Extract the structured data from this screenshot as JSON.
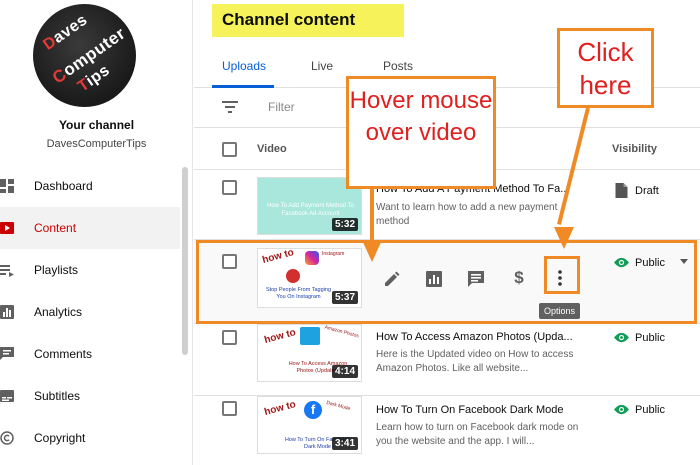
{
  "sidebar": {
    "logo_words": [
      "aves",
      "omputer",
      "ips"
    ],
    "logo_initials": [
      "D",
      "C",
      "T"
    ],
    "channel_label": "Your channel",
    "channel_name": "DavesComputerTips",
    "items": [
      {
        "label": "Dashboard",
        "icon": "dashboard-icon"
      },
      {
        "label": "Content",
        "icon": "content-icon",
        "active": true
      },
      {
        "label": "Playlists",
        "icon": "playlists-icon"
      },
      {
        "label": "Analytics",
        "icon": "analytics-icon"
      },
      {
        "label": "Comments",
        "icon": "comments-icon"
      },
      {
        "label": "Subtitles",
        "icon": "subtitles-icon"
      },
      {
        "label": "Copyright",
        "icon": "copyright-icon"
      }
    ]
  },
  "main": {
    "title": "Channel content",
    "tabs": [
      "Uploads",
      "Live",
      "Posts"
    ],
    "filter_placeholder": "Filter",
    "columns": {
      "video": "Video",
      "visibility": "Visibility"
    },
    "options_tooltip": "Options",
    "rows": [
      {
        "title": "How To Add A Payment Method To Fa...",
        "description": "Want to learn how to add a new payment method",
        "duration": "5:32",
        "visibility": "Draft",
        "thumb_text": "How To Add Payment Method To Facebook Ad Account"
      },
      {
        "title": "",
        "description": "",
        "duration": "5:37",
        "visibility": "Public",
        "thumb_text": "Stop People From Tagging You On Instagram",
        "thumb_tag": "Instagram"
      },
      {
        "title": "How To Access Amazon Photos (Upda...",
        "description": "Here is the Updated video on How to access Amazon Photos. Like all website...",
        "duration": "4:14",
        "visibility": "Public",
        "thumb_text": "How To Access Amazon Photos (Updated)",
        "thumb_tag": "Amazon Photos"
      },
      {
        "title": "How To Turn On Facebook Dark Mode",
        "description": "Learn how to turn on Facebook dark mode on you the website and the app. I will...",
        "duration": "3:41",
        "visibility": "Public",
        "thumb_text": "How To Turn On Facebook Dark Mode",
        "thumb_tag": "Dark Mode"
      }
    ]
  },
  "annotations": {
    "hover": "Hover mouse over video",
    "click": "Click here"
  },
  "colors": {
    "accent_blue": "#065fd4",
    "active_red": "#cc0000",
    "annotation_orange": "#f08a24",
    "annotation_text_red": "#e01f1f",
    "title_highlight": "#f6f35a",
    "public_green": "#0f9d58"
  }
}
